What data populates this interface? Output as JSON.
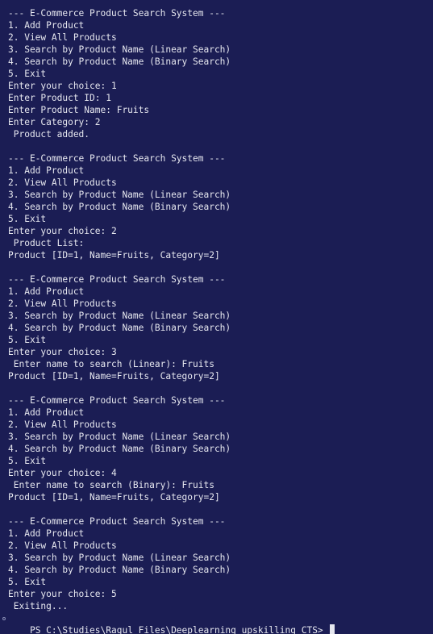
{
  "terminal": {
    "lines": [
      "--- E-Commerce Product Search System ---",
      "1. Add Product",
      "2. View All Products",
      "3. Search by Product Name (Linear Search)",
      "4. Search by Product Name (Binary Search)",
      "5. Exit",
      "Enter your choice: 1",
      "Enter Product ID: 1",
      "Enter Product Name: Fruits",
      "Enter Category: 2",
      " Product added.",
      "",
      "--- E-Commerce Product Search System ---",
      "1. Add Product",
      "2. View All Products",
      "3. Search by Product Name (Linear Search)",
      "4. Search by Product Name (Binary Search)",
      "5. Exit",
      "Enter your choice: 2",
      " Product List:",
      "Product [ID=1, Name=Fruits, Category=2]",
      "",
      "--- E-Commerce Product Search System ---",
      "1. Add Product",
      "2. View All Products",
      "3. Search by Product Name (Linear Search)",
      "4. Search by Product Name (Binary Search)",
      "5. Exit",
      "Enter your choice: 3",
      " Enter name to search (Linear): Fruits",
      "Product [ID=1, Name=Fruits, Category=2]",
      "",
      "--- E-Commerce Product Search System ---",
      "1. Add Product",
      "2. View All Products",
      "3. Search by Product Name (Linear Search)",
      "4. Search by Product Name (Binary Search)",
      "5. Exit",
      "Enter your choice: 4",
      " Enter name to search (Binary): Fruits",
      "Product [ID=1, Name=Fruits, Category=2]",
      "",
      "--- E-Commerce Product Search System ---",
      "1. Add Product",
      "2. View All Products",
      "3. Search by Product Name (Linear Search)",
      "4. Search by Product Name (Binary Search)",
      "5. Exit",
      "Enter your choice: 5",
      " Exiting..."
    ],
    "prompt": "PS C:\\Studies\\Ragul Files\\Deeplearning_upskilling_CTS> ",
    "colors": {
      "background": "#1b1d54",
      "foreground": "#e6e7ef"
    }
  }
}
